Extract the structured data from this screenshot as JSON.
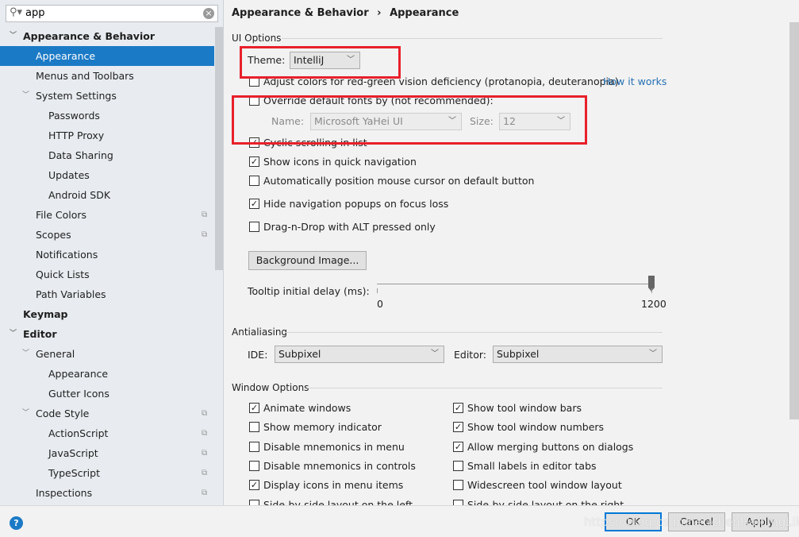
{
  "search": {
    "value": "app"
  },
  "sidebar": {
    "items": [
      {
        "label": "Appearance & Behavior",
        "level": 0,
        "bold": true,
        "arrow": true
      },
      {
        "label": "Appearance",
        "level": 1,
        "selected": true
      },
      {
        "label": "Menus and Toolbars",
        "level": 1
      },
      {
        "label": "System Settings",
        "level": 1,
        "arrow": true
      },
      {
        "label": "Passwords",
        "level": 2
      },
      {
        "label": "HTTP Proxy",
        "level": 2
      },
      {
        "label": "Data Sharing",
        "level": 2
      },
      {
        "label": "Updates",
        "level": 2
      },
      {
        "label": "Android SDK",
        "level": 2
      },
      {
        "label": "File Colors",
        "level": 1,
        "copy": true
      },
      {
        "label": "Scopes",
        "level": 1,
        "copy": true
      },
      {
        "label": "Notifications",
        "level": 1
      },
      {
        "label": "Quick Lists",
        "level": 1
      },
      {
        "label": "Path Variables",
        "level": 1
      },
      {
        "label": "Keymap",
        "level": 0,
        "bold": true
      },
      {
        "label": "Editor",
        "level": 0,
        "bold": true,
        "arrow": true
      },
      {
        "label": "General",
        "level": 1,
        "arrow": true
      },
      {
        "label": "Appearance",
        "level": 2
      },
      {
        "label": "Gutter Icons",
        "level": 2
      },
      {
        "label": "Code Style",
        "level": 1,
        "arrow": true,
        "copy": true
      },
      {
        "label": "ActionScript",
        "level": 2,
        "copy": true
      },
      {
        "label": "JavaScript",
        "level": 2,
        "copy": true
      },
      {
        "label": "TypeScript",
        "level": 2,
        "copy": true
      },
      {
        "label": "Inspections",
        "level": 1,
        "copy": true
      }
    ]
  },
  "breadcrumb": {
    "parent": "Appearance & Behavior",
    "sep": "›",
    "current": "Appearance"
  },
  "ui_options": {
    "title": "UI Options",
    "theme_label": "Theme:",
    "theme_value": "IntelliJ",
    "adjust_colors": {
      "label": "Adjust colors for red-green vision deficiency (protanopia, deuteranopia)",
      "checked": false
    },
    "how_it_works": "How it works",
    "override_fonts": {
      "label": "Override default fonts by (not recommended):",
      "checked": false
    },
    "name_label": "Name:",
    "name_value": "Microsoft YaHei UI",
    "size_label": "Size:",
    "size_value": "12",
    "cyclic": {
      "label": "Cyclic scrolling in list",
      "checked": true
    },
    "show_icons": {
      "label": "Show icons in quick navigation",
      "checked": true
    },
    "auto_cursor": {
      "label": "Automatically position mouse cursor on default button",
      "checked": false
    },
    "hide_popups": {
      "label": "Hide navigation popups on focus loss",
      "checked": true
    },
    "drag_drop": {
      "label": "Drag-n-Drop with ALT pressed only",
      "checked": false
    },
    "background_button": "Background Image...",
    "tooltip_label": "Tooltip initial delay (ms):",
    "tooltip_min": "0",
    "tooltip_max": "1200",
    "tooltip_value": 1200
  },
  "antialiasing": {
    "title": "Antialiasing",
    "ide_label": "IDE:",
    "ide_value": "Subpixel",
    "editor_label": "Editor:",
    "editor_value": "Subpixel"
  },
  "window_options": {
    "title": "Window Options",
    "left": [
      {
        "label": "Animate windows",
        "checked": true
      },
      {
        "label": "Show memory indicator",
        "checked": false
      },
      {
        "label": "Disable mnemonics in menu",
        "checked": false
      },
      {
        "label": "Disable mnemonics in controls",
        "checked": false
      },
      {
        "label": "Display icons in menu items",
        "checked": true
      },
      {
        "label": "Side-by-side layout on the left",
        "checked": false
      }
    ],
    "right": [
      {
        "label": "Show tool window bars",
        "checked": true
      },
      {
        "label": "Show tool window numbers",
        "checked": true
      },
      {
        "label": "Allow merging buttons on dialogs",
        "checked": true
      },
      {
        "label": "Small labels in editor tabs",
        "checked": false
      },
      {
        "label": "Widescreen tool window layout",
        "checked": false
      },
      {
        "label": "Side-by-side layout on the right",
        "checked": false
      }
    ]
  },
  "footer": {
    "help": "?",
    "ok": "OK",
    "cancel": "Cancel",
    "apply": "Apply",
    "watermark": "https://blog.csdn.net/chenHaiqingLike"
  },
  "colors": {
    "selection": "#1b7ac6",
    "highlight": "#e8202a",
    "link": "#2470b3"
  }
}
